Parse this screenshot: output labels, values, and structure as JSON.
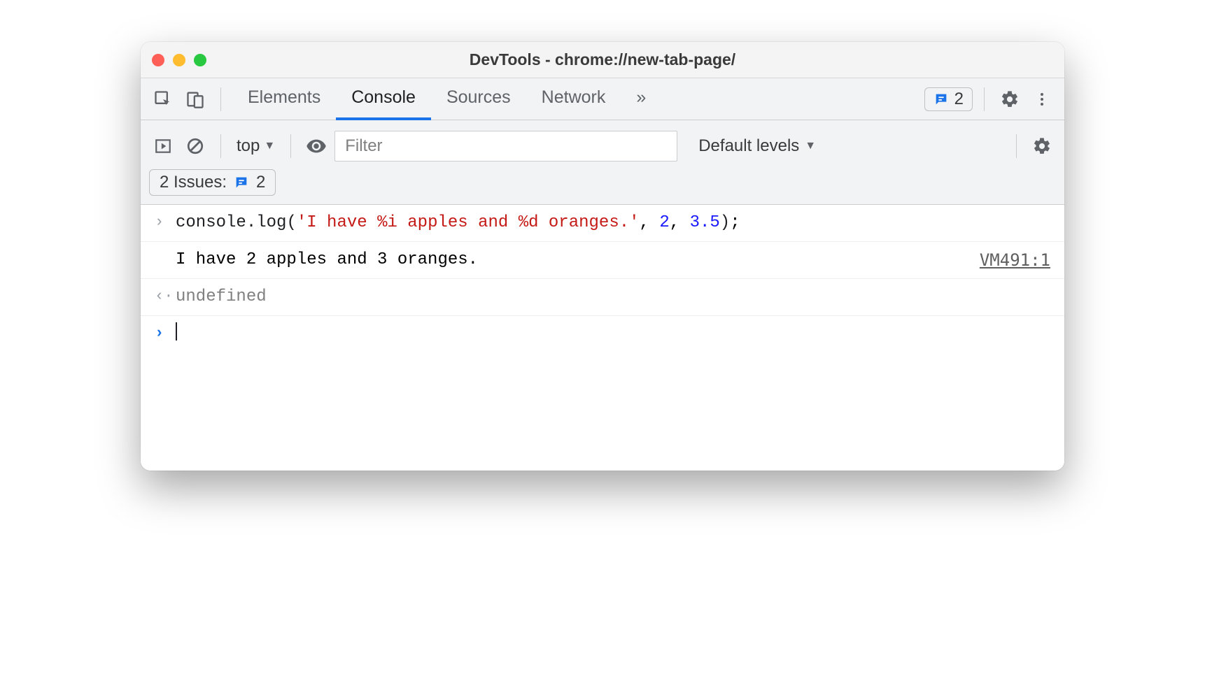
{
  "window": {
    "title": "DevTools - chrome://new-tab-page/"
  },
  "tabs": {
    "elements": "Elements",
    "console": "Console",
    "sources": "Sources",
    "network": "Network",
    "more": "»"
  },
  "header_issues": {
    "count": "2"
  },
  "toolbar": {
    "context": "top",
    "filter_placeholder": "Filter",
    "levels": "Default levels"
  },
  "issues_bar": {
    "label": "2 Issues:",
    "count": "2"
  },
  "console": {
    "input_method": "console.log",
    "input_lparen": "(",
    "input_str": "'I have %i apples and %d oranges.'",
    "input_sep1": ", ",
    "input_num1": "2",
    "input_sep2": ", ",
    "input_num2": "3.5",
    "input_rparen": ")",
    "input_semi": ";",
    "output_text": "I have 2 apples and 3 oranges.",
    "output_src": "VM491:1",
    "return_value": "undefined"
  }
}
